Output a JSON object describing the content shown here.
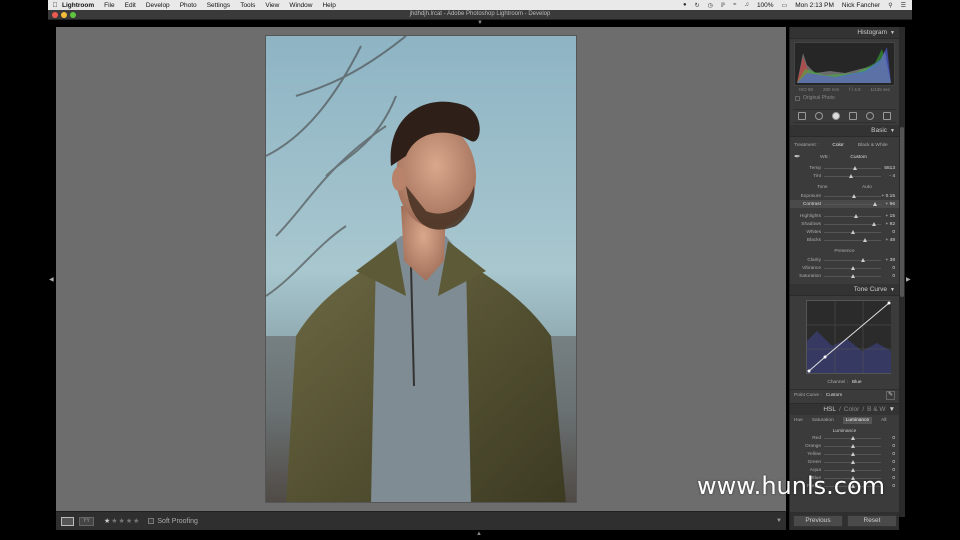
{
  "menubar": {
    "app": "Lightroom",
    "items": [
      "File",
      "Edit",
      "Develop",
      "Photo",
      "Settings",
      "Tools",
      "View",
      "Window",
      "Help"
    ],
    "battery": "100%",
    "clock": "Mon 2:13 PM",
    "user": "Nick Fancher"
  },
  "window": {
    "title": "jhdhdjh.lrcat - Adobe Photoshop Lightroom - Develop"
  },
  "toolbar": {
    "soft_proofing": "Soft Proofing"
  },
  "panel": {
    "histogram_title": "Histogram",
    "histo_info": [
      "ISO 50",
      "200 mm",
      "f / 4.0",
      "1/125 sec"
    ],
    "original_photo": "Original Photo",
    "basic_title": "Basic",
    "treatment_label": "Treatment :",
    "treatment_color": "Color",
    "treatment_bw": "Black & White",
    "wb_label": "WB :",
    "wb_value": "Custom",
    "tone_label": "Tone",
    "auto_label": "Auto",
    "presence_label": "Presence",
    "sliders_wb": [
      {
        "label": "Temp",
        "value": "5513",
        "pos": 0.55
      },
      {
        "label": "Tint",
        "value": "- 4",
        "pos": 0.48
      }
    ],
    "sliders_tone": [
      {
        "label": "Exposure",
        "value": "+ 0.15",
        "pos": 0.52
      },
      {
        "label": "Contrast",
        "value": "+ 96",
        "pos": 0.9
      }
    ],
    "sliders_tone2": [
      {
        "label": "Highlights",
        "value": "+ 15",
        "pos": 0.57
      },
      {
        "label": "Shadows",
        "value": "+ 92",
        "pos": 0.88
      },
      {
        "label": "Whites",
        "value": "0",
        "pos": 0.5
      },
      {
        "label": "Blacks",
        "value": "+ 48",
        "pos": 0.72
      }
    ],
    "sliders_presence": [
      {
        "label": "Clarity",
        "value": "+ 38",
        "pos": 0.68
      },
      {
        "label": "Vibrance",
        "value": "0",
        "pos": 0.5
      },
      {
        "label": "Saturation",
        "value": "0",
        "pos": 0.5
      }
    ],
    "tone_curve_title": "Tone Curve",
    "channel_label": "Channel :",
    "channel_value": "Blue",
    "point_curve_label": "Point Curve :",
    "point_curve_value": "Custom",
    "hsl_title": "HSL",
    "color_title": "Color",
    "bw_title": "B & W",
    "hsl_tabs": [
      "Hue",
      "Saturation",
      "Luminance",
      "All"
    ],
    "luminance_title": "Luminance",
    "sliders_lum": [
      {
        "label": "Red",
        "value": "0",
        "pos": 0.5
      },
      {
        "label": "Orange",
        "value": "0",
        "pos": 0.5
      },
      {
        "label": "Yellow",
        "value": "0",
        "pos": 0.5
      },
      {
        "label": "Green",
        "value": "0",
        "pos": 0.5
      },
      {
        "label": "Aqua",
        "value": "0",
        "pos": 0.5
      },
      {
        "label": "Blue",
        "value": "0",
        "pos": 0.5
      },
      {
        "label": "Purple",
        "value": "0",
        "pos": 0.5
      }
    ],
    "previous_button": "Previous",
    "reset_button": "Reset"
  },
  "watermark": "www.hunls.com",
  "colors": {
    "panel_bg": "#3b3b3b",
    "canvas_bg": "#6d6d6d",
    "menubar_bg": "#e9e9e9"
  }
}
